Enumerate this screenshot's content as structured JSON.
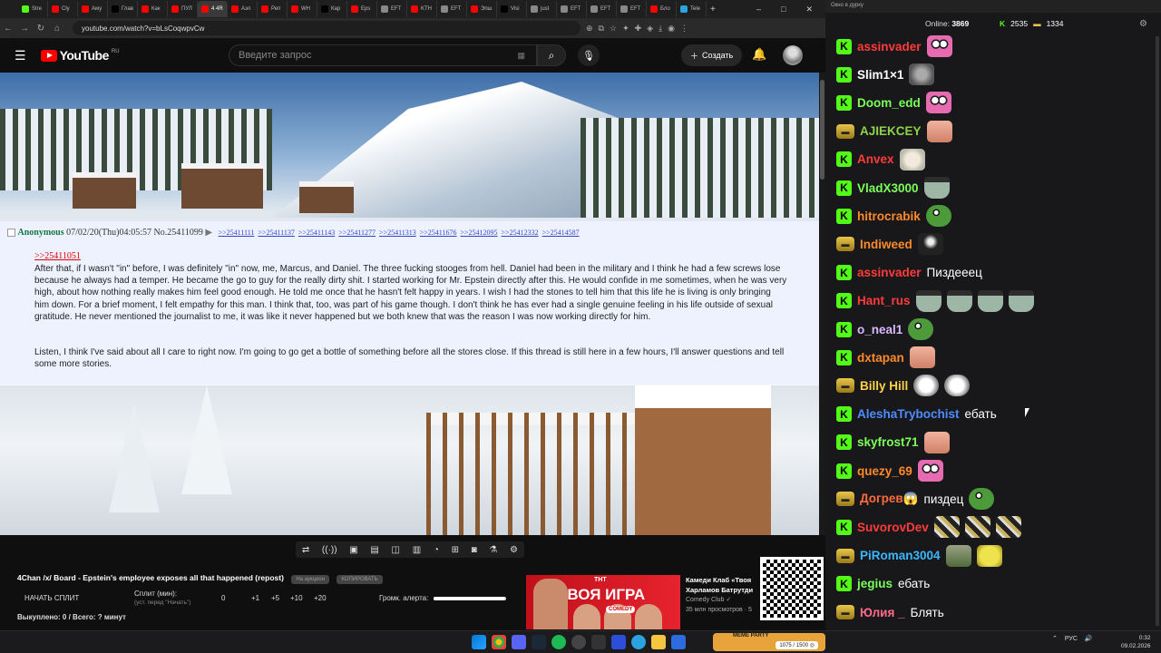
{
  "browser": {
    "tabs": [
      {
        "label": "Strе",
        "color": "#53fc18"
      },
      {
        "label": "Clу",
        "color": "#ff0000"
      },
      {
        "label": "Аму",
        "color": "#ff0000"
      },
      {
        "label": "Глав",
        "color": "#000000"
      },
      {
        "label": "Как",
        "color": "#ff0000"
      },
      {
        "label": "ПУЛ",
        "color": "#ff0000"
      },
      {
        "label": "4 4R",
        "color": "#ff0000"
      },
      {
        "label": "Аэп",
        "color": "#ff0000"
      },
      {
        "label": "Реп",
        "color": "#ff0000"
      },
      {
        "label": "WH",
        "color": "#ff0000"
      },
      {
        "label": "Кар",
        "color": "#000000"
      },
      {
        "label": "Eps",
        "color": "#ff0000"
      },
      {
        "label": "EFT",
        "color": "#888888"
      },
      {
        "label": "KTH",
        "color": "#ff0000"
      },
      {
        "label": "EFT",
        "color": "#888888"
      },
      {
        "label": "Эпш",
        "color": "#ff0000"
      },
      {
        "label": "Visi",
        "color": "#000000"
      },
      {
        "label": "just",
        "color": "#888888"
      },
      {
        "label": "EFT",
        "color": "#888888"
      },
      {
        "label": "EFT",
        "color": "#888888"
      },
      {
        "label": "EFT",
        "color": "#888888"
      },
      {
        "label": "Бло",
        "color": "#ff0000"
      },
      {
        "label": "Tele",
        "color": "#2aa3df"
      }
    ],
    "active_tab_index": 6,
    "new_tab": "+",
    "url": "youtube.com/watch?v=bLsCoqwpvCw",
    "window_controls": [
      "–",
      "□",
      "✕"
    ]
  },
  "youtube": {
    "logo_text": "YouTube",
    "region": "RU",
    "search_placeholder": "Введите запрос",
    "create_label": "Создать",
    "menu_icon": "hamburger-icon",
    "search_icon": "search-icon",
    "mic_icon": "mic-icon",
    "bell_icon": "bell-icon"
  },
  "post": {
    "name": "Anonymous",
    "datetime": "07/02/20(Thu)04:05:57",
    "number": "No.25411099",
    "arrow": "▶",
    "backlinks": [
      ">>25411111",
      ">>25411137",
      ">>25411143",
      ">>25411277",
      ">>25411313",
      ">>25411676",
      ">>25412095",
      ">>25412332",
      ">>25414587"
    ],
    "quote": ">>25411051",
    "paragraphs": [
      "After that, if I wasn't \"in\" before, I was definitely \"in\" now, me, Marcus, and Daniel. The three fucking stooges from hell. Daniel had been in the military and I think he had a few screws lose because he always had a temper. He became the go to guy for the really dirty shit. I started working for Mr. Epstein directly after this. He would confide in me sometimes, when he was very high, about how nothing really makes him feel good enough. He told me once that he hasn't felt happy in years. I wish I had the stones to tell him that this life he is living is only bringing him down. For a brief moment, I felt empathy for this man. I think that, too, was part of his game though. I don't think he has ever had a single genuine feeling in his life outside of sexual gratitude. He never mentioned the journalist to me, it was like it never happened but we both knew that was the reason I was now working directly for him.",
      "Listen, I think I've said about all I care to right now. I'm going to go get a bottle of something before all the stores close. If this thread is still here in a few hours, I'll answer questions and tell some more stories."
    ]
  },
  "controls": {
    "toolbar_icons": [
      "⇄",
      "((·))",
      "▣",
      "▤",
      "◫",
      "▥",
      "◔",
      "⊞",
      "◙",
      "⚗",
      "⚙"
    ],
    "video_title": "4Chan /x/ Board - Epstein's employee exposes all that happened (repost)",
    "pill1": "На аукцион",
    "pill2": "КОПИРОВАТЬ",
    "start_split": "НАЧАТЬ СПЛИТ",
    "split_label": "Сплит (мин):",
    "split_sub": "(уст. перед \"Начать\")",
    "split_value": "0",
    "steps": [
      "+1",
      "+5",
      "+10",
      "+20"
    ],
    "volume_label": "Громк. алерта:",
    "volume_level": 0.97,
    "summary": "Выкуплено: 0 / Всего: ? минут"
  },
  "ad": {
    "brand_tag": "ТНТ",
    "title": "ТВОЯ ИГРА",
    "logo": "COMEDY"
  },
  "recommendation": {
    "title": "Камеди Клаб «Твоя Харламов Батрутди",
    "channel": "Comedy Club",
    "views": "35 млн просмотров · 5"
  },
  "chat": {
    "window_title": "Окно в дурку",
    "online_label": "Online:",
    "online_count": "3869",
    "stat1": "2535",
    "stat2": "1334",
    "colors": {
      "kick": "#53fc18"
    },
    "messages": [
      {
        "user": "assinvader",
        "color": "#ff3b3b",
        "badge": "k",
        "text": "",
        "emotes": [
          "pink"
        ]
      },
      {
        "user": "Slim1×1",
        "color": "#ffffff",
        "badge": "k",
        "text": "",
        "emotes": [
          "gray"
        ]
      },
      {
        "user": "Doom_edd",
        "color": "#7cff5a",
        "badge": "k",
        "text": "",
        "emotes": [
          "pink"
        ]
      },
      {
        "user": "AJIEKCEY",
        "color": "#8fd24a",
        "badge": "g",
        "text": "",
        "emotes": [
          "skin"
        ]
      },
      {
        "user": "Anvex",
        "color": "#ff3b3b",
        "badge": "k",
        "text": "",
        "emotes": [
          "cat"
        ]
      },
      {
        "user": "VladX3000",
        "color": "#7cff5a",
        "badge": "k",
        "text": "",
        "emotes": [
          "bucket"
        ]
      },
      {
        "user": "hitrocrabik",
        "color": "#ff8a2a",
        "badge": "k",
        "text": "",
        "emotes": [
          "pepe"
        ]
      },
      {
        "user": "Indiweed",
        "color": "#ff8a2a",
        "badge": "g",
        "text": "",
        "emotes": [
          "dark"
        ]
      },
      {
        "user": "assinvader",
        "color": "#ff3b3b",
        "badge": "k",
        "text": "Пиздееец",
        "emotes": []
      },
      {
        "user": "Hant_rus",
        "color": "#ff3b3b",
        "badge": "k",
        "text": "",
        "emotes": [
          "bucket",
          "bucket",
          "bucket",
          "bucket"
        ]
      },
      {
        "user": "o_neal1",
        "color": "#d9b8ff",
        "badge": "k",
        "text": "",
        "emotes": [
          "pepe"
        ]
      },
      {
        "user": "dxtapan",
        "color": "#ff8a2a",
        "badge": "k",
        "text": "",
        "emotes": [
          "skin"
        ]
      },
      {
        "user": "Billy Hill",
        "color": "#ffd24a",
        "badge": "g",
        "text": "",
        "emotes": [
          "troll",
          "troll"
        ]
      },
      {
        "user": "AleshaTrybochist",
        "color": "#4f8cff",
        "badge": "k",
        "text": "ебать",
        "emotes": []
      },
      {
        "user": "skyfrost71",
        "color": "#7cff5a",
        "badge": "k",
        "text": "",
        "emotes": [
          "skin"
        ]
      },
      {
        "user": "quezy_69",
        "color": "#ff8a2a",
        "badge": "k",
        "text": "",
        "emotes": [
          "pink"
        ]
      },
      {
        "user": "Догрев😱",
        "color": "#ff6b3b",
        "badge": "g",
        "text": "пиздец",
        "emotes": [
          "pepe"
        ]
      },
      {
        "user": "SuvorovDev",
        "color": "#ff3b3b",
        "badge": "k",
        "text": "",
        "emotes": [
          "stripe",
          "stripe",
          "stripe"
        ]
      },
      {
        "user": "PiRoman3004",
        "color": "#3ab7ff",
        "badge": "g",
        "text": "",
        "emotes": [
          "rock",
          "sponge"
        ]
      },
      {
        "user": "jegius",
        "color": "#7cff5a",
        "badge": "k",
        "text": "ебать",
        "emotes": []
      },
      {
        "user": "Юлия _",
        "color": "#ff6b8a",
        "badge": "g",
        "text": "Блять",
        "emotes": []
      }
    ]
  },
  "taskbar": {
    "mini_label": "1075 / 1500 ◎",
    "mini_brand": "MEME PARTY",
    "lang": "РУС",
    "time": "0:32",
    "date": "09.02.2026"
  }
}
